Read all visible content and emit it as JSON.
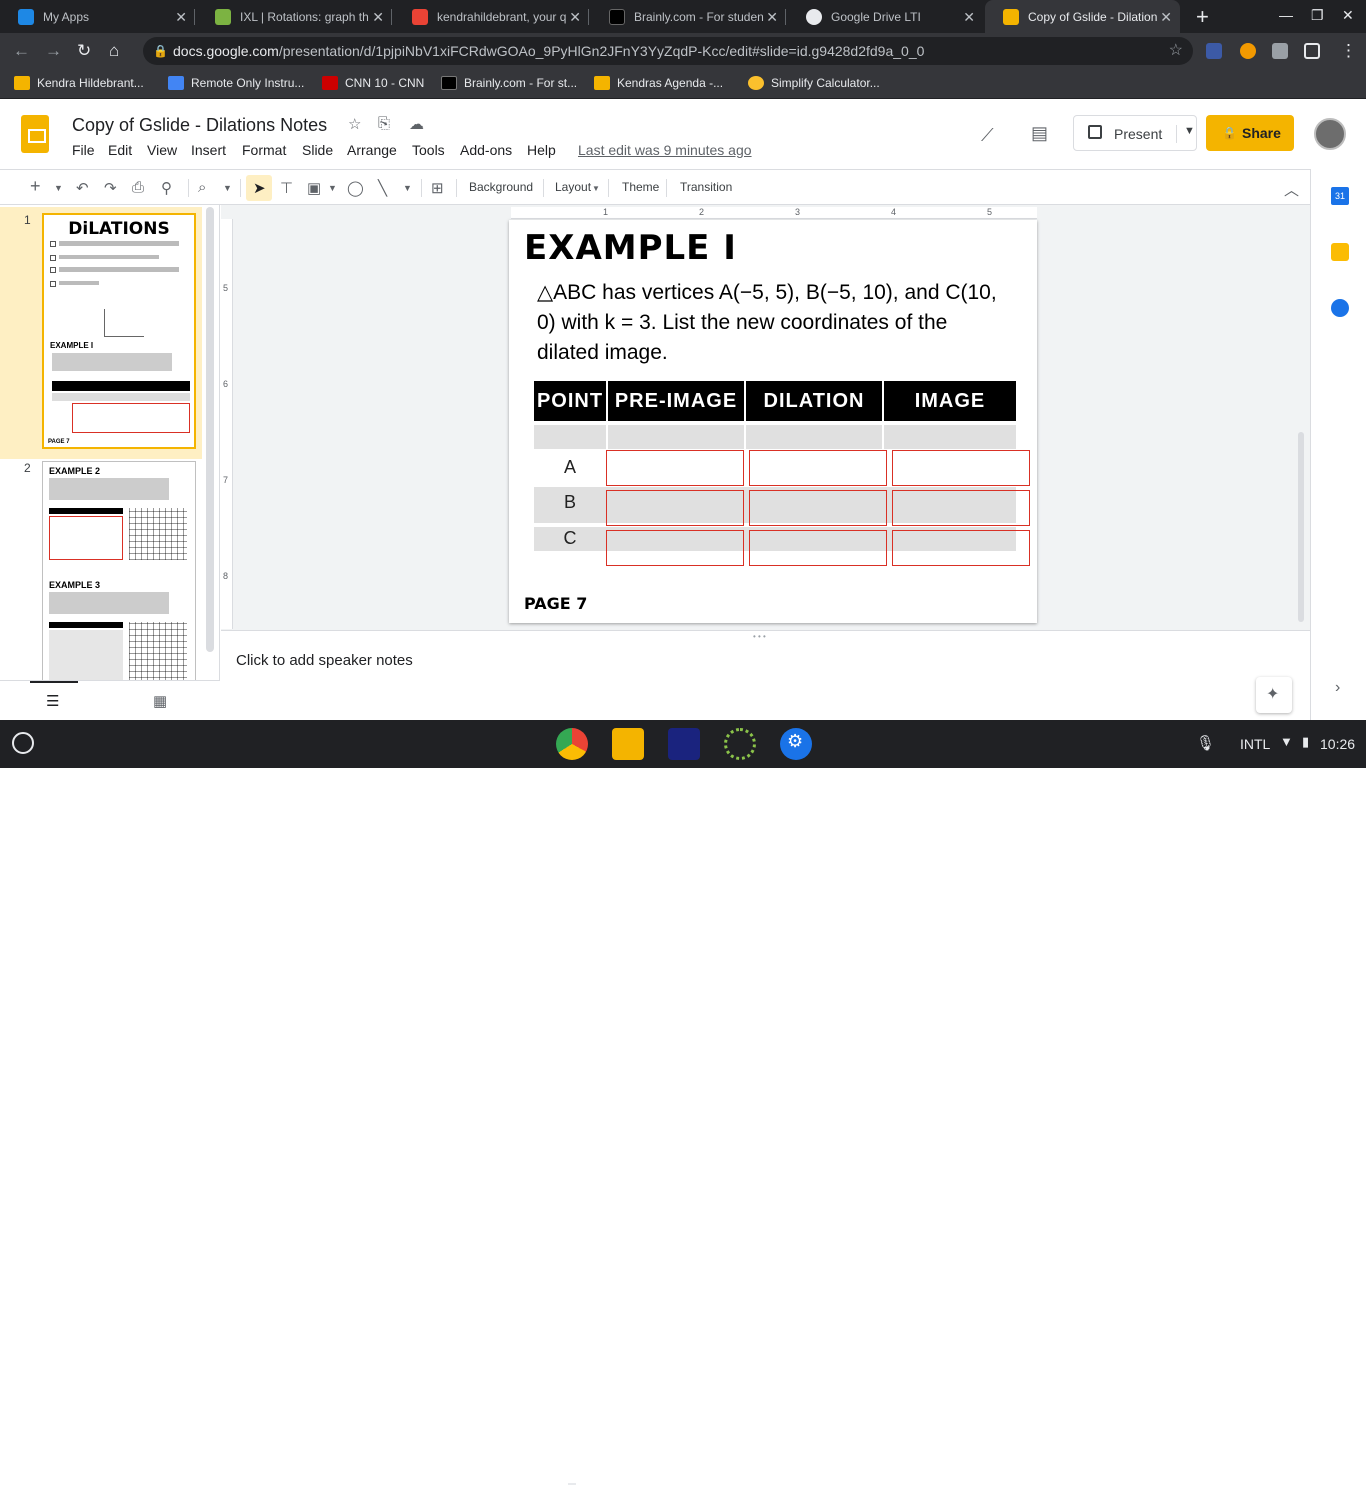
{
  "tabs": [
    {
      "title": "My Apps",
      "fav": "#1e88e5"
    },
    {
      "title": "IXL | Rotations: graph th",
      "fav": "#7cb342"
    },
    {
      "title": "kendrahildebrant, your q",
      "fav": "#ea4335"
    },
    {
      "title": "Brainly.com - For studen",
      "fav": "#202124"
    },
    {
      "title": "Google Drive LTI",
      "fav": "#e8eaed"
    },
    {
      "title": "Copy of Gslide - Dilation",
      "fav": "#f4b400"
    }
  ],
  "url": {
    "host": "docs.google.com",
    "path": "/presentation/d/1pjpiNbV1xiFCRdwGOAo_9PyHlGn2JFnY3YyZqdP-Kcc/edit#slide=id.g9428d2fd9a_0_0"
  },
  "bookmarks": [
    {
      "label": "Kendra Hildebrant...",
      "color": "#f4b400"
    },
    {
      "label": "Remote Only Instru...",
      "color": "#4285f4"
    },
    {
      "label": "CNN 10 - CNN",
      "color": "#cc0000"
    },
    {
      "label": "Brainly.com - For st...",
      "color": "#202124"
    },
    {
      "label": "Kendras Agenda -...",
      "color": "#f4b400"
    },
    {
      "label": "Simplify Calculator...",
      "color": "#fbc02d"
    }
  ],
  "doc": {
    "title": "Copy of Gslide - Dilations Notes",
    "last_edit": "Last edit was 9 minutes ago"
  },
  "menus": [
    "File",
    "Edit",
    "View",
    "Insert",
    "Format",
    "Slide",
    "Arrange",
    "Tools",
    "Add-ons",
    "Help"
  ],
  "buttons": {
    "present": "Present",
    "share": "Share"
  },
  "toolbar": {
    "background": "Background",
    "layout": "Layout",
    "theme": "Theme",
    "transition": "Transition"
  },
  "filmstrip": {
    "slide1": "1",
    "slide2": "2",
    "t1": "DiLATIONS",
    "t2a": "EXAMPLE 2",
    "t2b": "EXAMPLE 3"
  },
  "ruler": {
    "h": [
      "1",
      "2",
      "3",
      "4",
      "5"
    ],
    "v": [
      "5",
      "6",
      "7",
      "8"
    ]
  },
  "slide": {
    "title": "EXAMPLE I",
    "prompt": "△ABC has vertices A(−5, 5), B(−5, 10), and C(10, 0) with k = 3. List the new coordinates of the dilated image.",
    "headers": [
      "POINT",
      "PRE-IMAGE",
      "DILATION",
      "IMAGE"
    ],
    "rows": [
      "A",
      "B",
      "C"
    ],
    "footer": "PAGE 7"
  },
  "notes": "Click to add speaker notes",
  "shelf": {
    "lang": "INTL",
    "time": "10:26"
  }
}
